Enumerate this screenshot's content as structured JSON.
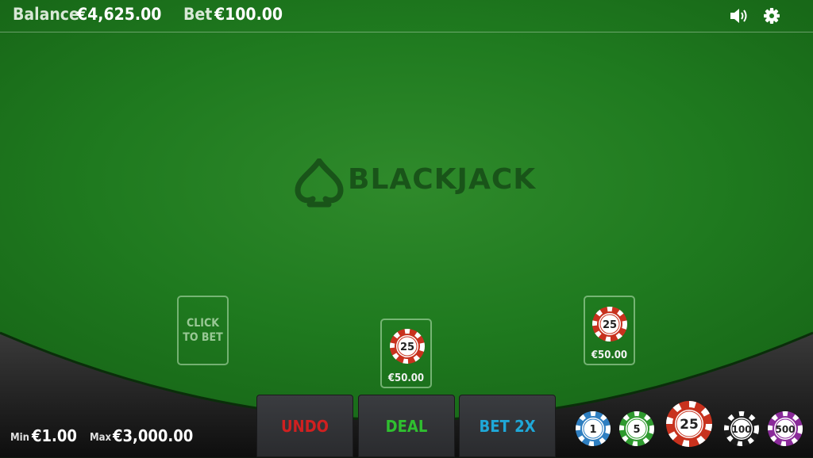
{
  "header": {
    "balance_label": "Balance",
    "balance_value": "€4,625.00",
    "bet_label": "Bet",
    "bet_value": "€100.00",
    "sound_icon": "speaker-icon",
    "settings_icon": "gear-icon"
  },
  "logo": {
    "text": "BLACKJACK",
    "icon": "spade-icon"
  },
  "spots": [
    {
      "text_line1": "CLICK",
      "text_line2": "TO BET"
    },
    {
      "chip_value": "25",
      "amount": "€50.00"
    },
    {
      "chip_value": "25",
      "amount": "€50.00"
    }
  ],
  "actions": {
    "undo": "UNDO",
    "deal": "DEAL",
    "bet2x": "BET 2X"
  },
  "limits": {
    "min_label": "Min",
    "min_value": "€1.00",
    "max_label": "Max",
    "max_value": "€3,000.00"
  },
  "chips": [
    {
      "value": "1",
      "color": "#2f7fc1"
    },
    {
      "value": "5",
      "color": "#2f9a2f"
    },
    {
      "value": "25",
      "color": "#c8321e"
    },
    {
      "value": "100",
      "color": "#1c1c1c"
    },
    {
      "value": "500",
      "color": "#8a2a9a"
    }
  ],
  "colors": {
    "felt": "#1f7a1f",
    "undo": "#d02020",
    "deal": "#2fbf2f",
    "bet2x": "#1fa8d8"
  }
}
